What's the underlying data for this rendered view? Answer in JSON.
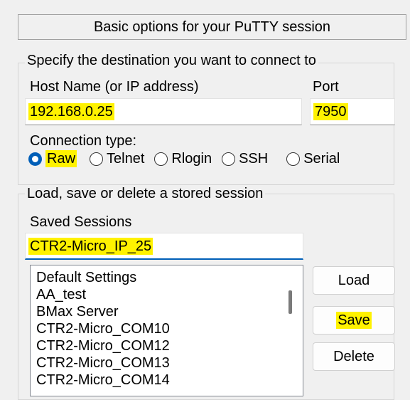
{
  "header": {
    "title": "Basic options for your PuTTY session"
  },
  "destination": {
    "group_title": "Specify the destination you want to connect to",
    "host_label": "Host Name (or IP address)",
    "host_value": "192.168.0.25",
    "port_label": "Port",
    "port_value": "7950",
    "connection_type_label": "Connection type:",
    "connection_types": [
      {
        "label": "Raw",
        "checked": true
      },
      {
        "label": "Telnet",
        "checked": false
      },
      {
        "label": "Rlogin",
        "checked": false
      },
      {
        "label": "SSH",
        "checked": false
      },
      {
        "label": "Serial",
        "checked": false
      }
    ]
  },
  "sessions": {
    "group_title": "Load, save or delete a stored session",
    "saved_sessions_label": "Saved Sessions",
    "saved_session_value": "CTR2-Micro_IP_25",
    "list": [
      "Default Settings",
      "AA_test",
      "BMax Server",
      "CTR2-Micro_COM10",
      "CTR2-Micro_COM12",
      "CTR2-Micro_COM13",
      "CTR2-Micro_COM14"
    ],
    "buttons": {
      "load": "Load",
      "save": "Save",
      "delete": "Delete"
    }
  },
  "colors": {
    "highlight": "#fff200",
    "accent": "#005fb8"
  }
}
